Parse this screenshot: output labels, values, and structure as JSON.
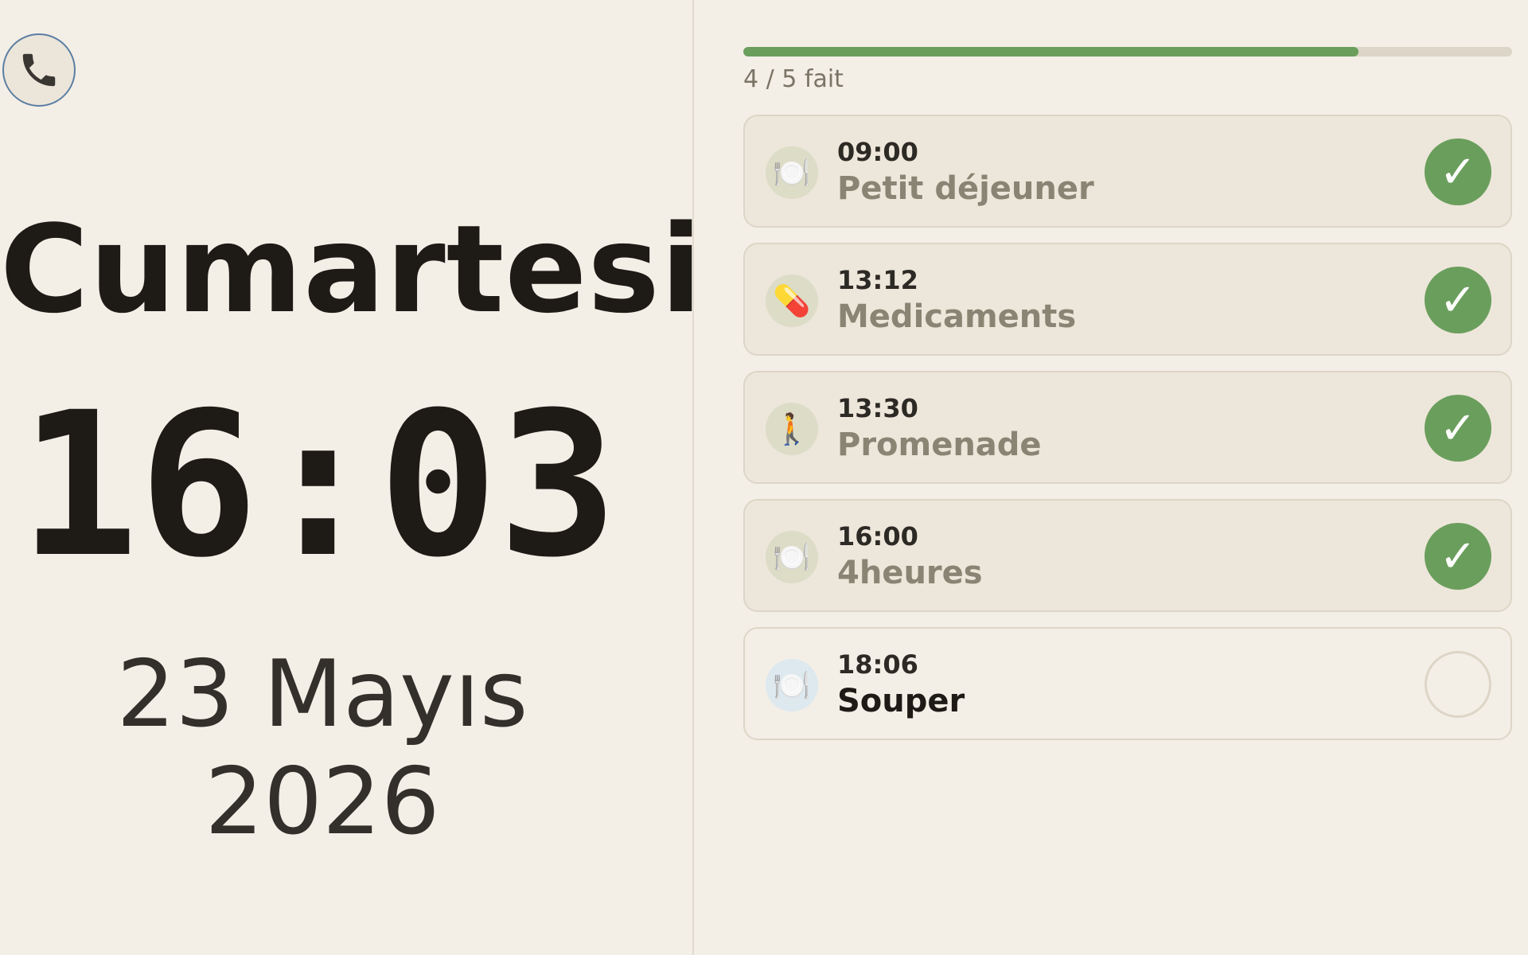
{
  "colors": {
    "background": "#f3efe7",
    "accent_green": "#6a9e5c",
    "call_border": "#5b7ea3"
  },
  "call_button": {
    "icon": "phone-icon"
  },
  "clock": {
    "day": "Cumartesi",
    "time": "16:03",
    "date": "23 Mayıs 2026"
  },
  "progress": {
    "completed": 4,
    "total": 5,
    "label": "4 / 5 fait"
  },
  "tasks": [
    {
      "time": "09:00",
      "label": "Petit déjeuner",
      "icon": "meal-icon",
      "emoji": "🍽️",
      "done": true
    },
    {
      "time": "13:12",
      "label": "Medicaments",
      "icon": "pill-icon",
      "emoji": "💊",
      "done": true
    },
    {
      "time": "13:30",
      "label": "Promenade",
      "icon": "walk-icon",
      "emoji": "🚶",
      "done": true
    },
    {
      "time": "16:00",
      "label": "4heures",
      "icon": "meal-icon",
      "emoji": "🍽️",
      "done": true
    },
    {
      "time": "18:06",
      "label": "Souper",
      "icon": "meal-icon",
      "emoji": "🍽️",
      "done": false
    }
  ],
  "check_mark": "✓"
}
